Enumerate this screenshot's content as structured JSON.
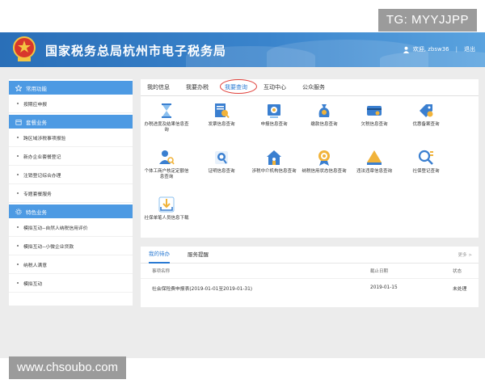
{
  "overlay": {
    "tg": "TG: MYYJJPP",
    "watermark": "www.chsoubo.com"
  },
  "header": {
    "title": "国家税务总局杭州市电子税务局",
    "user": "欢迎, zbsw36",
    "logout": "退出",
    "bg_color": "#3a84cc"
  },
  "sidebar": {
    "sections": [
      {
        "title": "常用功能",
        "icon": "star-icon",
        "items": [
          "按期应申报"
        ]
      },
      {
        "title": "套餐业务",
        "icon": "package-icon",
        "items": [
          "跨区域涉税事项报验",
          "新办企业套餐登记",
          "注销登记综合办理",
          "专题套餐服务"
        ]
      },
      {
        "title": "特色业务",
        "icon": "gear-icon",
        "items": [
          "模拟互动--自然人纳税信用评价",
          "模拟互动--小微企业贷款",
          "纳税人满意",
          "模拟互动"
        ]
      }
    ]
  },
  "tabs": [
    "我的信息",
    "我要办税",
    "我要查询",
    "互动中心",
    "公众服务"
  ],
  "active_tab": "我要查询",
  "query_icons": [
    {
      "label": "办税进度及结果信息查询",
      "icon": "hourglass-icon"
    },
    {
      "label": "发票信息查询",
      "icon": "invoice-search-icon"
    },
    {
      "label": "申报信息查询",
      "icon": "declaration-search-icon"
    },
    {
      "label": "缴款信息查询",
      "icon": "payment-bag-icon"
    },
    {
      "label": "欠税信息查询",
      "icon": "arrears-card-icon"
    },
    {
      "label": "优惠备案查询",
      "icon": "discount-tag-icon"
    },
    {
      "label": "个体工商户核定定额信息查询",
      "icon": "person-search-icon"
    },
    {
      "label": "证明信息查询",
      "icon": "certificate-search-icon"
    },
    {
      "label": "涉税中介机构信息查询",
      "icon": "agency-house-icon"
    },
    {
      "label": "纳税信用状态信息查询",
      "icon": "credit-medal-icon"
    },
    {
      "label": "违法违章信息查询",
      "icon": "warning-triangle-icon"
    },
    {
      "label": "社保登记查询",
      "icon": "social-search-icon"
    },
    {
      "label": "社保单笔人员信息下载",
      "icon": "download-icon"
    }
  ],
  "todo": {
    "tabs": [
      "我的待办",
      "服务提醒"
    ],
    "more": "更多 >",
    "columns": [
      "事项名称",
      "截止日期",
      "状态"
    ],
    "rows": [
      {
        "name": "社会保险费申报表(2019-01-01至2019-01-31)",
        "date": "2019-01-15",
        "status": "未处理"
      }
    ]
  }
}
